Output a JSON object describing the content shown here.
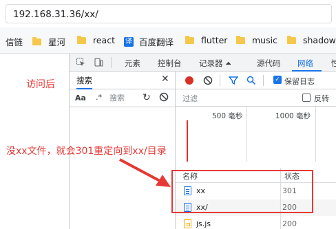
{
  "address_bar": {
    "url": "192.168.31.36/xx/"
  },
  "bookmarks": [
    {
      "label": "信链",
      "icon": "none"
    },
    {
      "label": "星河",
      "icon": "folder-icon"
    },
    {
      "label": "react",
      "icon": "folder-icon"
    },
    {
      "label": "百度翻译",
      "icon": "baidu-translate-icon",
      "icon_text": "译"
    },
    {
      "label": "flutter",
      "icon": "folder-icon"
    },
    {
      "label": "music",
      "icon": "folder-icon"
    },
    {
      "label": "shadow",
      "icon": "folder-icon"
    }
  ],
  "annotations": {
    "after_visit": "访问后",
    "explanation": "没xx文件，就会301重定向到xx/目录"
  },
  "devtools": {
    "tabs": [
      {
        "label": "元素"
      },
      {
        "label": "控制台"
      },
      {
        "label": "记录器 ⏶"
      },
      {
        "label": "源代码"
      },
      {
        "label": "网络",
        "active": true
      },
      {
        "label": "性"
      }
    ],
    "search_panel": {
      "title": "搜索",
      "case_label": "Aa",
      "regex_label": ".*",
      "search_placeholder": "搜索"
    },
    "network": {
      "preserve_log_label": "保留日志",
      "filter_placeholder": "过滤",
      "invert_label": "反转",
      "timeline_labels": [
        "500 毫秒",
        "1000 毫秒"
      ],
      "columns": {
        "name": "名称",
        "status": "状态"
      },
      "rows": [
        {
          "name": "xx",
          "status": "301",
          "type": "document"
        },
        {
          "name": "xx/",
          "status": "200",
          "type": "document"
        },
        {
          "name": "js.js",
          "status": "200",
          "type": "script"
        }
      ]
    }
  },
  "colors": {
    "accent": "#1a73e8",
    "annotation_red": "#e53935",
    "record_red": "#d93025",
    "folder_yellow": "#f5c84c"
  }
}
